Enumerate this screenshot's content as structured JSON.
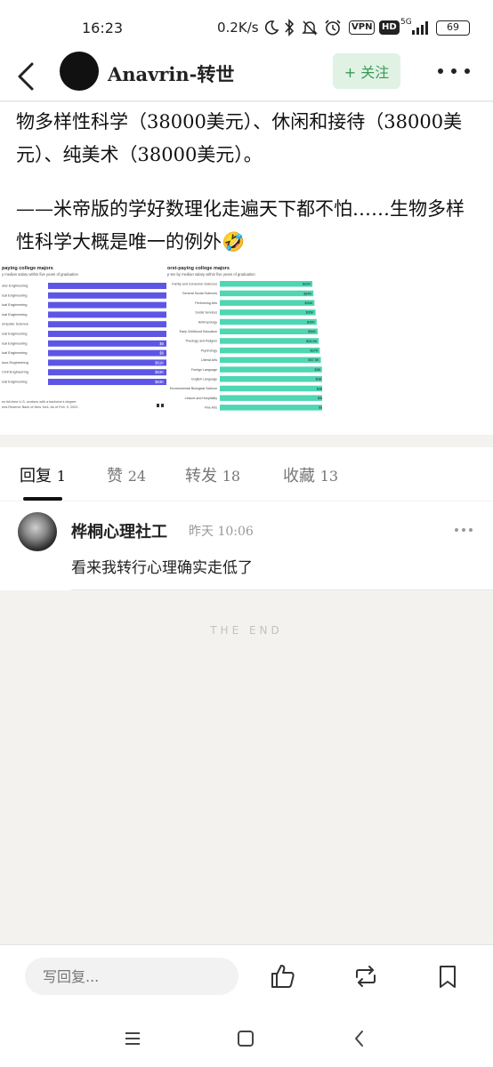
{
  "status_bar": {
    "time": "16:23",
    "net_speed": "0.2K/s",
    "vpn": "VPN",
    "hd": "HD",
    "signal": "5G",
    "battery": "69"
  },
  "header": {
    "author": "Anavrin-转世",
    "follow_label": "+ 关注"
  },
  "article": {
    "paragraph1": "物多样性科学（38000美元）、休闲和接待（38000美元）、纯美术（38000美元）。",
    "paragraph2": "——米帝版的学好数理化走遍天下都不怕……生物多样性科学大概是唯一的例外🤣"
  },
  "embedded_image": {
    "left_title": "paying college majors",
    "left_subtitle": "y median salary within five years of graduation",
    "left_labels": [
      "uter Engineering",
      "ical Engineering",
      "ical Engineering",
      "ical Engineering",
      "omputer Science",
      "ical Engineering",
      "ical Engineering",
      "ical Engineering",
      "ious Engineering",
      "Civil Engineering",
      "ical Engineering"
    ],
    "left_values": [
      "",
      "",
      "",
      "",
      "",
      "",
      "$6",
      "$6",
      "$61K",
      "$63K",
      "$63K"
    ],
    "left_footnote1": "es full-time U.S. workers with a bachelor's degree.",
    "left_footnote2": "eral Reserve Bank of New York. As of Feb. 9, 2022.",
    "right_title": "orst-paying college majors",
    "right_subtitle": "p ten by median salary within five years of graduation",
    "right_labels": [
      "Family and Consumer Sciences",
      "General Social Sciences",
      "Performing Arts",
      "Social Services",
      "Anthropology",
      "Early Childhood Education",
      "Theology and Religion",
      "Psychology",
      "Liberal Arts",
      "Foreign Language",
      "English Language",
      "Environmental Biological Science",
      "Leisure and Hospitality",
      "Fine Arts"
    ],
    "right_values": [
      "$32K",
      "$34K",
      "$34K",
      "$35K",
      "$35K",
      "$36K",
      "$35.5K",
      "$37K",
      "$37.5K",
      "$38",
      "$38",
      "$38",
      "$38",
      "$38"
    ],
    "left_color": "#5c55e6",
    "right_color": "#4fd6b2"
  },
  "tabs": [
    {
      "label": "回复",
      "count": "1"
    },
    {
      "label": "赞",
      "count": "24"
    },
    {
      "label": "转发",
      "count": "18"
    },
    {
      "label": "收藏",
      "count": "13"
    }
  ],
  "comment": {
    "name": "桦桐心理社工",
    "time": "昨天 10:06",
    "text": "看来我转行心理确实走低了"
  },
  "footer": {
    "the_end": "THE END",
    "reply_placeholder": "写回复..."
  }
}
